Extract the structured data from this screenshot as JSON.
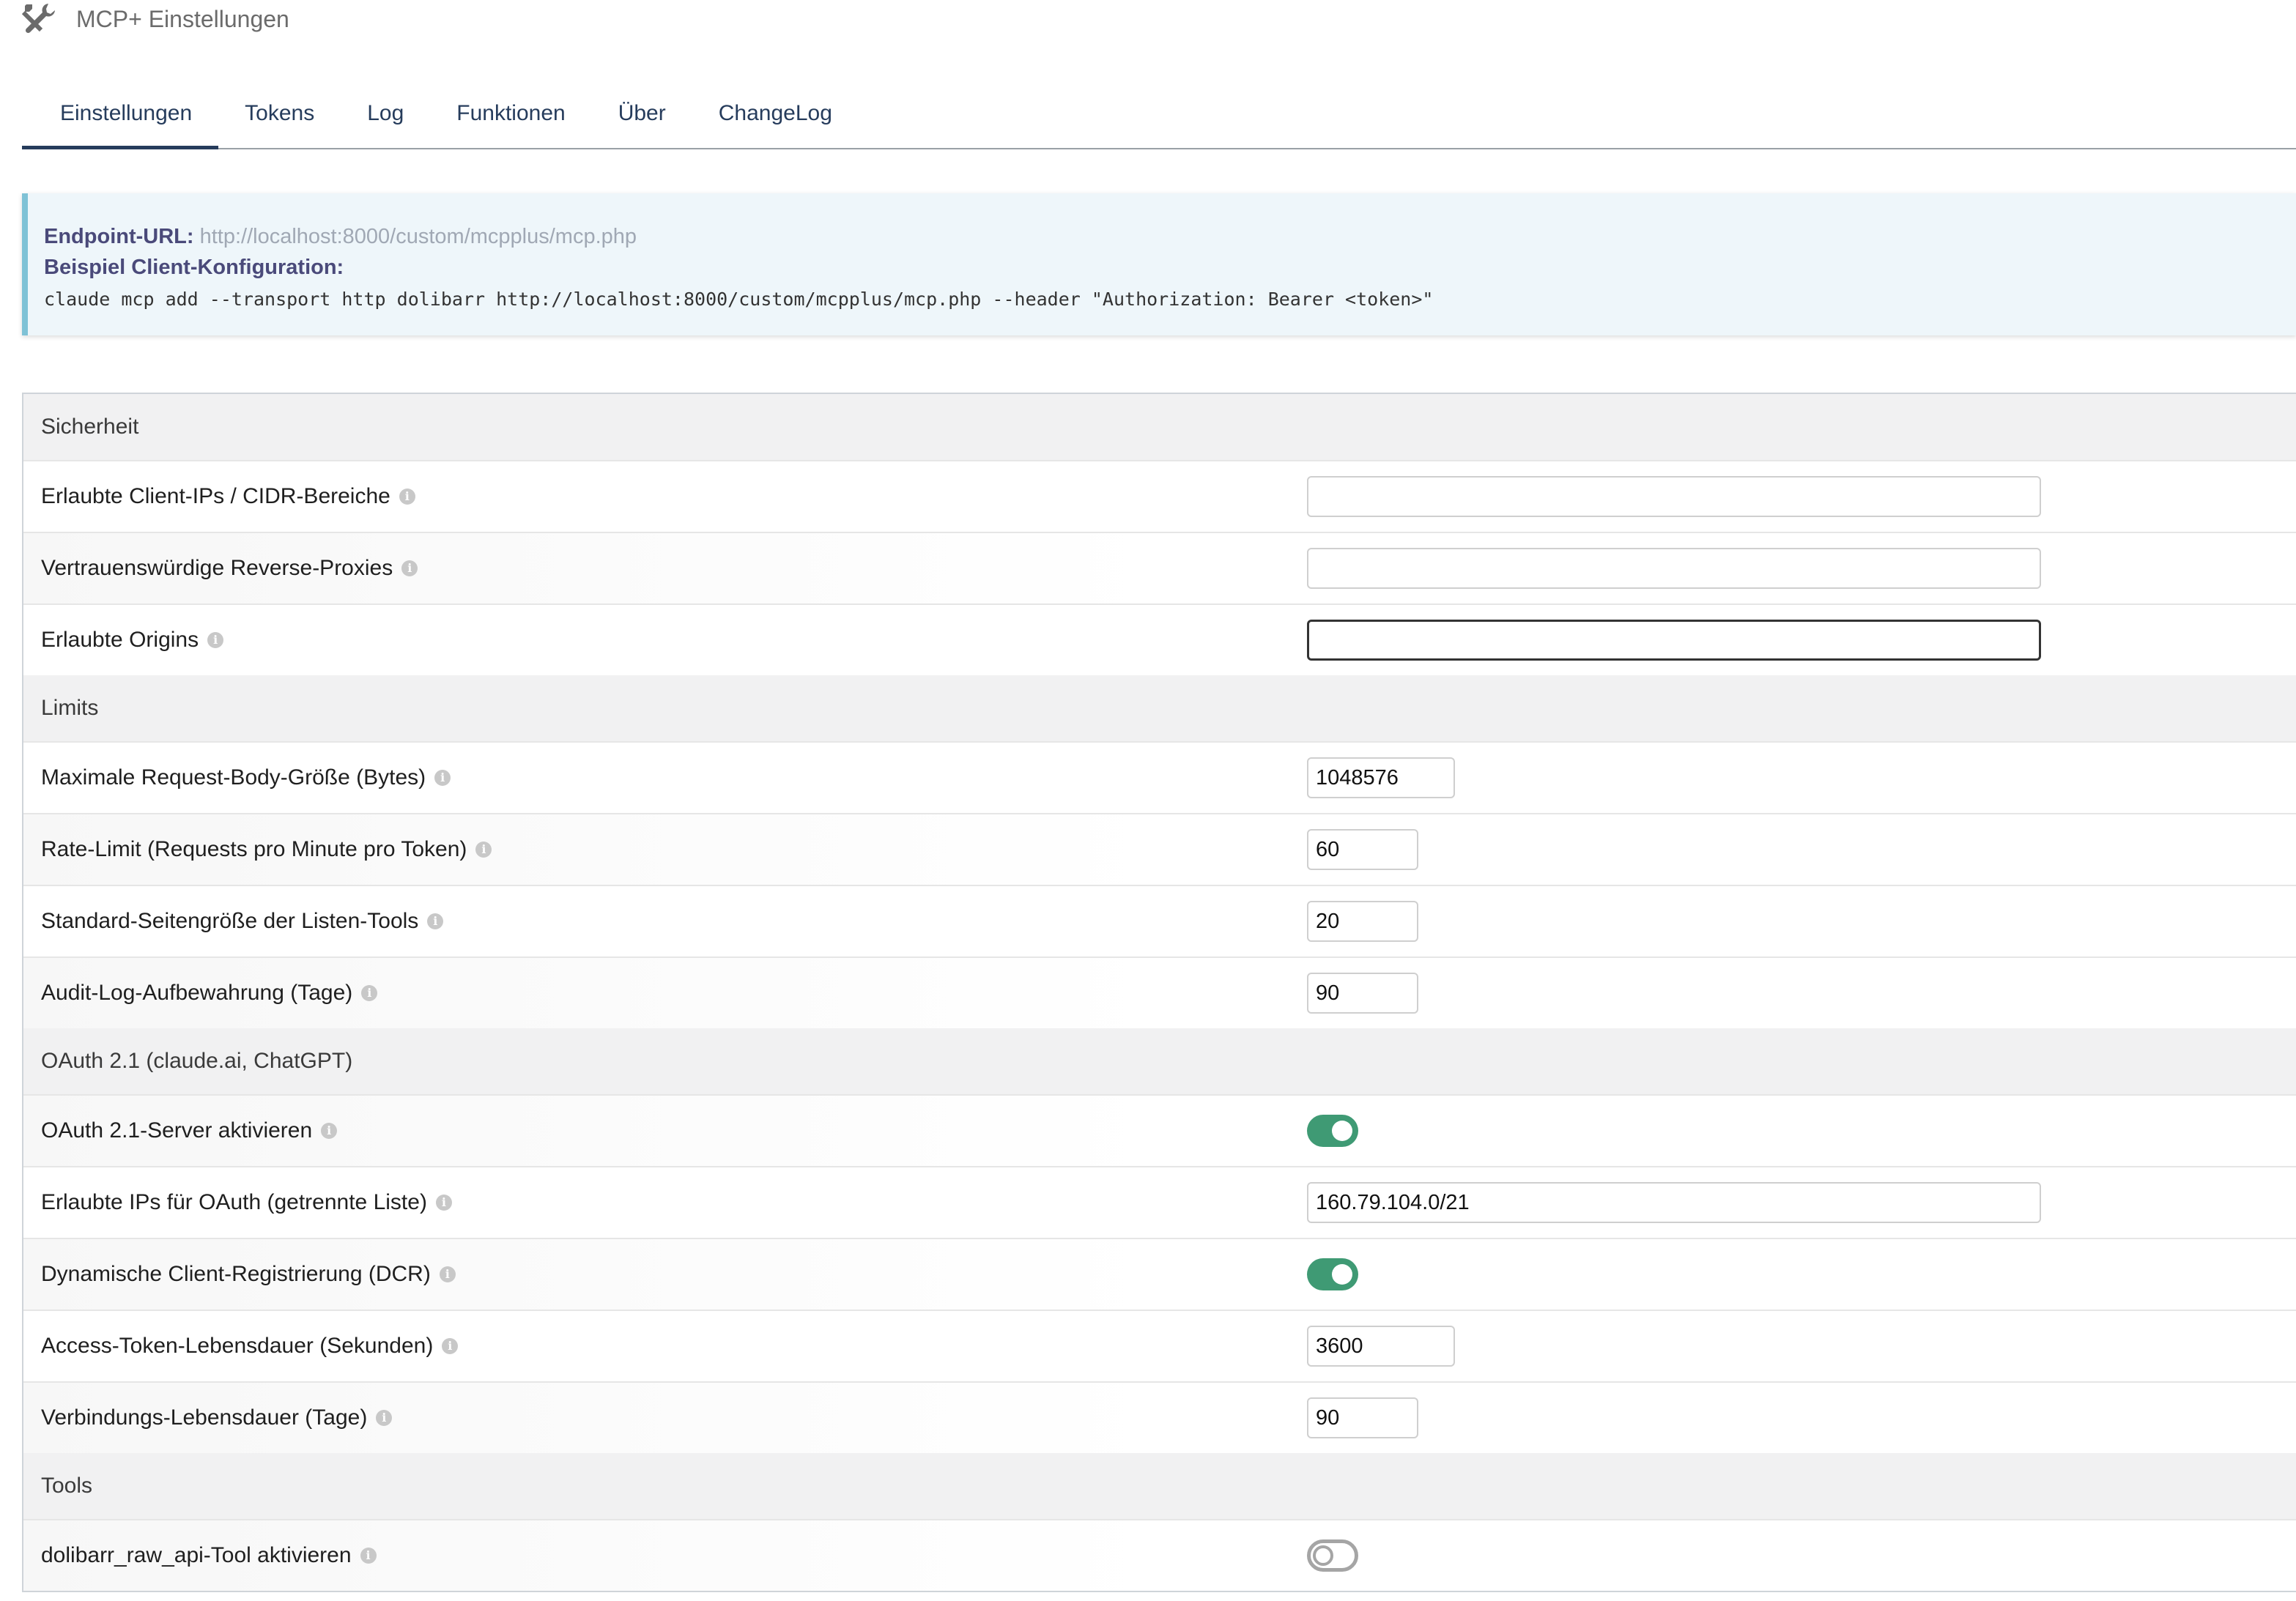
{
  "header": {
    "title": "MCP+ Einstellungen",
    "icon": "wrench-screwdriver-icon"
  },
  "tabs": [
    {
      "label": "Einstellungen",
      "active": true
    },
    {
      "label": "Tokens",
      "active": false
    },
    {
      "label": "Log",
      "active": false
    },
    {
      "label": "Funktionen",
      "active": false
    },
    {
      "label": "Über",
      "active": false
    },
    {
      "label": "ChangeLog",
      "active": false
    }
  ],
  "info": {
    "endpoint_label": "Endpoint-URL:",
    "endpoint_url": "http://localhost:8000/custom/mcpplus/mcp.php",
    "example_label": "Beispiel Client-Konfiguration:",
    "example_command": "claude mcp add --transport http dolibarr http://localhost:8000/custom/mcpplus/mcp.php --header \"Authorization: Bearer <token>\""
  },
  "sections": {
    "security": {
      "title": "Sicherheit",
      "allowed_ips_label": "Erlaubte Client-IPs / CIDR-Bereiche",
      "allowed_ips_value": "",
      "trusted_proxies_label": "Vertrauenswürdige Reverse-Proxies",
      "trusted_proxies_value": "",
      "allowed_origins_label": "Erlaubte Origins",
      "allowed_origins_value": ""
    },
    "limits": {
      "title": "Limits",
      "max_body_label": "Maximale Request-Body-Größe (Bytes)",
      "max_body_value": "1048576",
      "rate_limit_label": "Rate-Limit (Requests pro Minute pro Token)",
      "rate_limit_value": "60",
      "page_size_label": "Standard-Seitengröße der Listen-Tools",
      "page_size_value": "20",
      "audit_retention_label": "Audit-Log-Aufbewahrung (Tage)",
      "audit_retention_value": "90"
    },
    "oauth": {
      "title": "OAuth 2.1 (claude.ai, ChatGPT)",
      "enable_label": "OAuth 2.1-Server aktivieren",
      "enable_on": true,
      "allowed_ips_label": "Erlaubte IPs für OAuth (getrennte Liste)",
      "allowed_ips_value": "160.79.104.0/21",
      "dcr_label": "Dynamische Client-Registrierung (DCR)",
      "dcr_on": true,
      "token_lifetime_label": "Access-Token-Lebensdauer (Sekunden)",
      "token_lifetime_value": "3600",
      "connection_lifetime_label": "Verbindungs-Lebensdauer (Tage)",
      "connection_lifetime_value": "90"
    },
    "tools": {
      "title": "Tools",
      "raw_api_label": "dolibarr_raw_api-Tool aktivieren",
      "raw_api_on": false
    }
  },
  "colors": {
    "accent": "#263c5c",
    "toggle_on": "#3f9a74",
    "toggle_off": "#a5a5a5",
    "info_border": "#7fc2d6"
  }
}
